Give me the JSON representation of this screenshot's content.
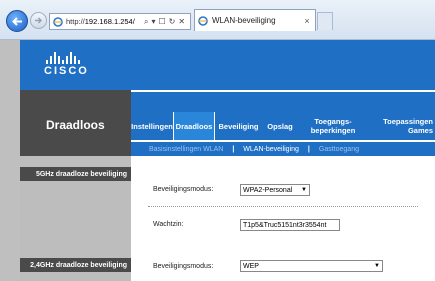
{
  "browser": {
    "address_prefix": "http://",
    "address_host": "192.168.1.254/",
    "search_glyph": "⌕",
    "dropdown_glyph": "▾",
    "lock_glyph": "☐",
    "refresh_glyph": "↻",
    "stop_glyph": "✕",
    "tab_title": "WLAN-beveiliging",
    "tab_close": "×"
  },
  "brand": {
    "logo_text": "CISCO"
  },
  "section": {
    "title": "Draadloos"
  },
  "menu": {
    "items": [
      {
        "label": "Instellingen"
      },
      {
        "label": "Draadloos"
      },
      {
        "label": "Beveiliging"
      },
      {
        "label": "Opslag"
      },
      {
        "label": "Toegangs-\nbeperkingen"
      },
      {
        "label": "Toepassingen\nGames"
      }
    ],
    "active_index": 1
  },
  "submenu": {
    "items": [
      {
        "label": "Basisinstellingen WLAN"
      },
      {
        "label": "WLAN-beveiliging"
      },
      {
        "label": "Gasttoegang"
      }
    ],
    "separator": "|"
  },
  "sections": {
    "ghz5": {
      "label": "5GHz draadloze beveiliging",
      "mode_label": "Beveiligingsmodus:",
      "mode_value": "WPA2-Personal",
      "passphrase_label": "Wachtzin:",
      "passphrase_value": "T1p5&Truc5151nt3r3554nt"
    },
    "ghz24": {
      "label": "2,4GHz draadloze beveiliging",
      "mode_label": "Beveiligingsmodus:",
      "mode_value": "WEP"
    }
  },
  "colors": {
    "brand_blue": "#1f6fc4",
    "dark_gray": "#4a4a4a",
    "light_gray": "#bdbdbd"
  }
}
